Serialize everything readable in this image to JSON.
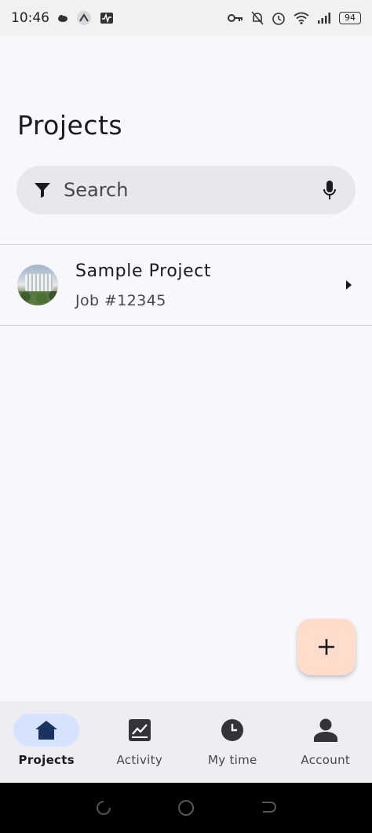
{
  "status_bar": {
    "time": "10:46",
    "battery": "94"
  },
  "page": {
    "title": "Projects"
  },
  "search": {
    "placeholder": "Search"
  },
  "projects": [
    {
      "name": "Sample Project",
      "job": "Job #12345"
    }
  ],
  "fab": {
    "icon": "plus-icon"
  },
  "bottom_nav": {
    "items": [
      {
        "label": "Projects",
        "icon": "home-icon",
        "active": true
      },
      {
        "label": "Activity",
        "icon": "chart-icon",
        "active": false
      },
      {
        "label": "My time",
        "icon": "clock-icon",
        "active": false
      },
      {
        "label": "Account",
        "icon": "person-icon",
        "active": false
      }
    ]
  },
  "colors": {
    "background": "#f8f8fc",
    "search_bg": "#e7e7ec",
    "fab_bg": "#ffdccb",
    "nav_bg": "#ededf2",
    "nav_active_pill": "#d6e3ff",
    "nav_icon": "#1c3260"
  }
}
